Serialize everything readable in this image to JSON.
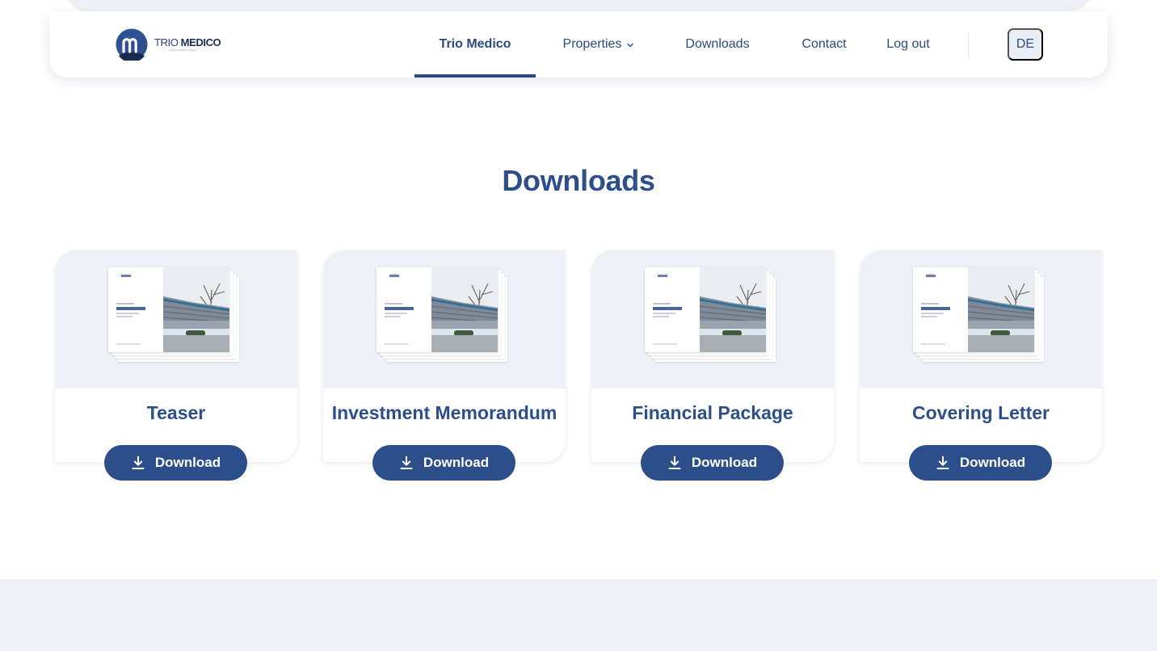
{
  "brand": {
    "logo_light": "TRIO",
    "logo_bold": "MEDICO",
    "tagline": "Investment Memorandum"
  },
  "nav": {
    "items": [
      {
        "label": "Trio Medico",
        "active": true
      },
      {
        "label": "Properties",
        "has_dropdown": true
      },
      {
        "label": "Downloads"
      },
      {
        "label": "Contact"
      },
      {
        "label": "Log out"
      }
    ],
    "language": "DE"
  },
  "main": {
    "heading": "Downloads",
    "cards": [
      {
        "title": "Teaser",
        "button_label": "Download"
      },
      {
        "title": "Investment Memorandum",
        "button_label": "Download"
      },
      {
        "title": "Financial Package",
        "button_label": "Download"
      },
      {
        "title": "Covering Letter",
        "button_label": "Download"
      }
    ]
  },
  "icons": {
    "logo": "trio-medico-logo-icon",
    "dropdown": "chevron-down-icon",
    "download": "download-icon"
  },
  "colors": {
    "primary": "#2c4f8c",
    "nav_text": "#2c4a80",
    "surface": "#edf1f7",
    "background": "#ffffff"
  }
}
